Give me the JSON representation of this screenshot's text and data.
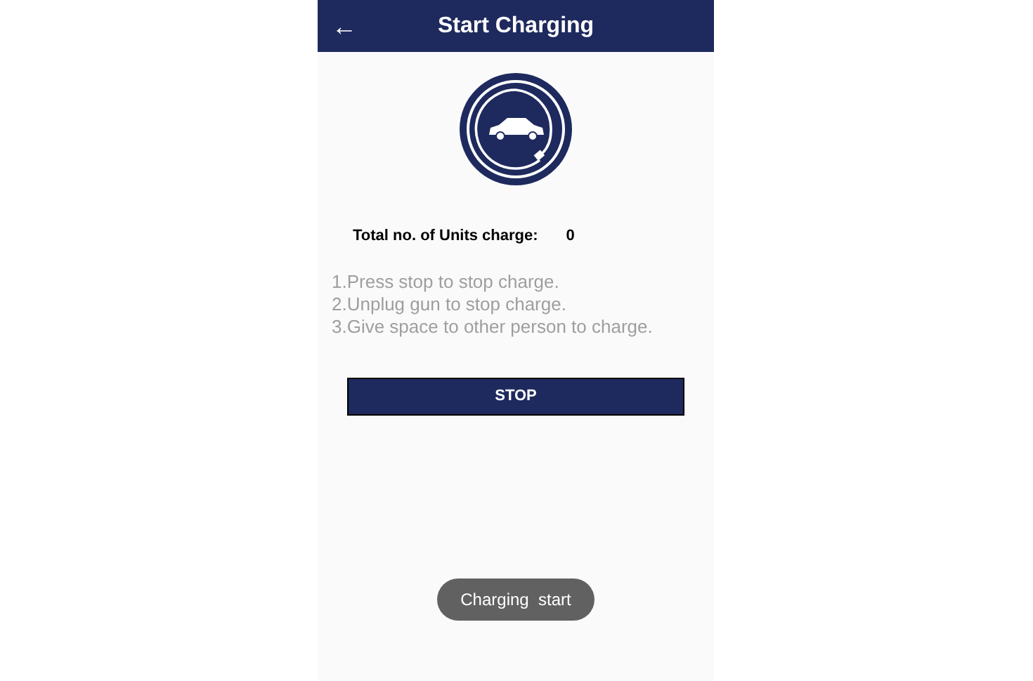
{
  "app_bar": {
    "back": "←",
    "title": "Start Charging"
  },
  "units": {
    "label": "Total no. of Units charge:",
    "value": "0"
  },
  "instructions": [
    "1.Press stop to stop charge.",
    "2.Unplug gun to stop charge.",
    "3.Give space to other person to charge."
  ],
  "stop_button": "STOP",
  "toast": "Charging  start"
}
